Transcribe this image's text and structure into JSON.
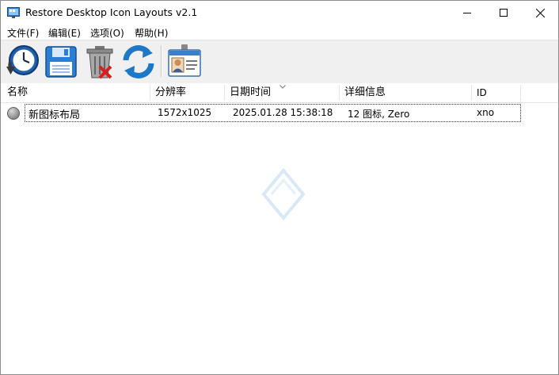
{
  "window": {
    "title": "Restore Desktop Icon Layouts v2.1",
    "controls": {
      "minimize": "minimize",
      "maximize": "maximize",
      "close": "close"
    }
  },
  "menubar": {
    "items": [
      {
        "label": "文件(F)"
      },
      {
        "label": "编辑(E)"
      },
      {
        "label": "选项(O)"
      },
      {
        "label": "帮助(H)"
      }
    ]
  },
  "toolbar": {
    "buttons": [
      {
        "icon": "restore-clock-icon"
      },
      {
        "icon": "save-floppy-icon"
      },
      {
        "icon": "delete-trash-icon"
      },
      {
        "icon": "refresh-arrows-icon"
      },
      {
        "icon": "id-card-icon"
      }
    ]
  },
  "list": {
    "columns": [
      {
        "label": "名称"
      },
      {
        "label": "分辨率"
      },
      {
        "label": "日期时间"
      },
      {
        "label": "详细信息"
      },
      {
        "label": "ID"
      }
    ],
    "sorted_column": "日期时间",
    "rows": [
      {
        "status": "gray",
        "name": "新图标布局",
        "resolution": "1572x1025",
        "datetime": "2025.01.28 15:38:18",
        "details": "12 图标, Zero",
        "id": "xno"
      }
    ]
  },
  "colors": {
    "accent_blue": "#1e6fc6",
    "toolbar_bg": "#f0f0f0",
    "status_gray": "#8a8a8a"
  }
}
